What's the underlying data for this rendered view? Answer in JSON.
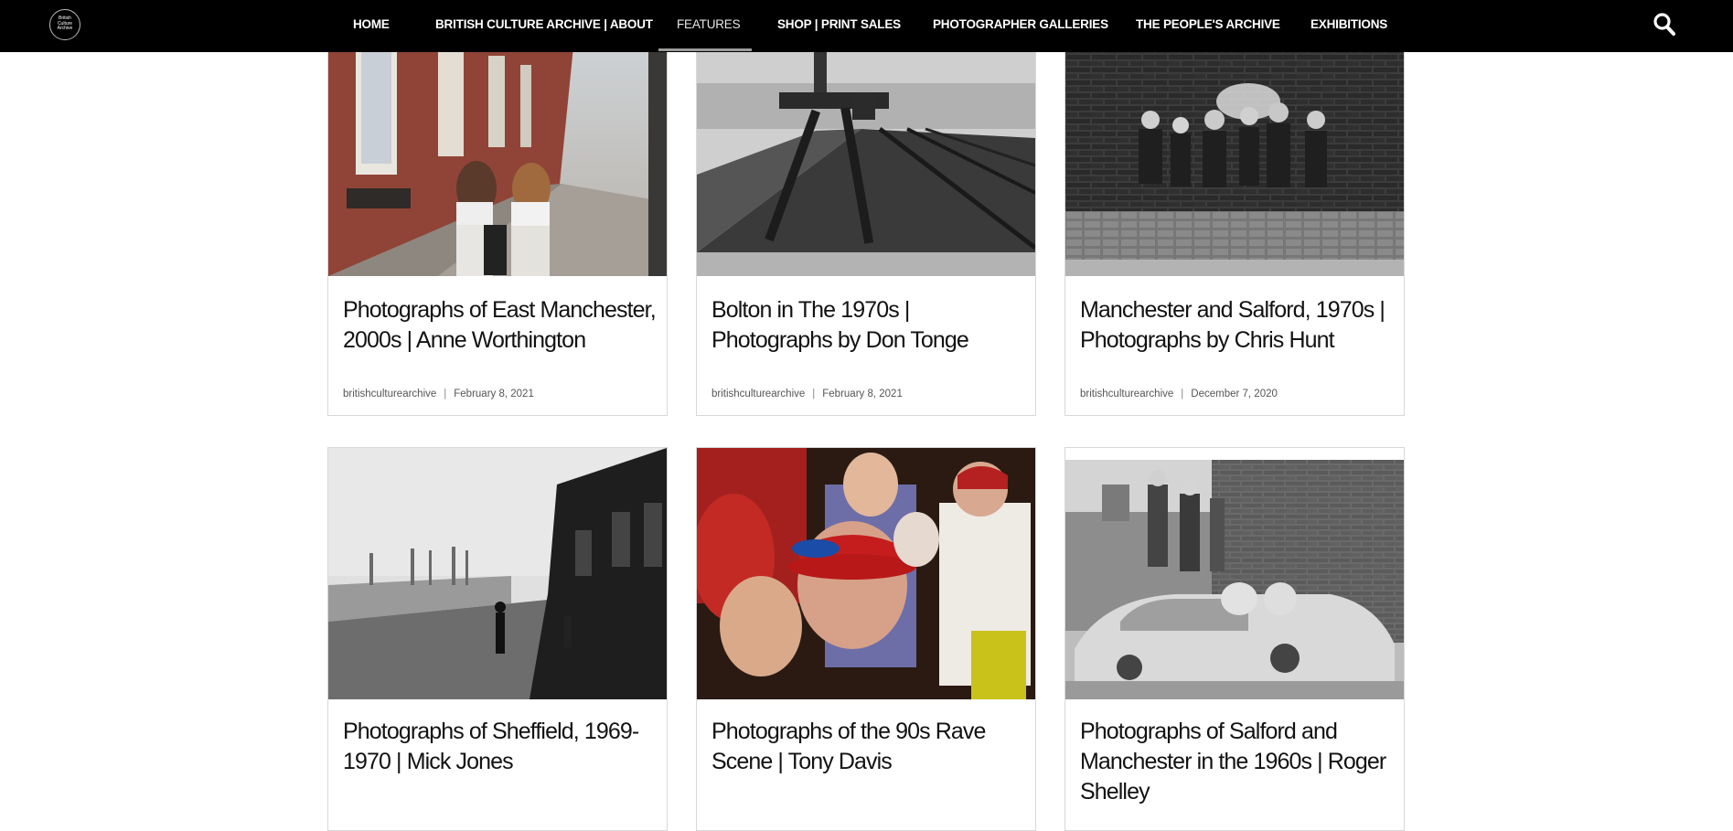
{
  "site": {
    "logo_text": "British Culture Archive",
    "nav": [
      {
        "label": "HOME"
      },
      {
        "label": "BRITISH CULTURE ARCHIVE | ABOUT"
      },
      {
        "label": "FEATURES"
      },
      {
        "label": "SHOP | PRINT SALES"
      },
      {
        "label": "PHOTOGRAPHER GALLERIES"
      },
      {
        "label": "THE PEOPLE'S ARCHIVE"
      },
      {
        "label": "EXHIBITIONS"
      }
    ],
    "active_nav": "FEATURES",
    "search_icon": "search-icon"
  },
  "posts": [
    {
      "title": "Photographs of East Manchester, 2000s | Anne Worthington",
      "author": "britishculturearchive",
      "date": "February 8, 2021",
      "image": "colour street photo of two girls with a pram"
    },
    {
      "title": "Bolton in The 1970s | Photographs by Don Tonge",
      "author": "britishculturearchive",
      "date": "February 8, 2021",
      "image": "black and white photo of railway track"
    },
    {
      "title": "Manchester and Salford, 1970s | Photographs by Chris Hunt",
      "author": "britishculturearchive",
      "date": "December 7, 2020",
      "image": "black and white photo of children against brick wall"
    },
    {
      "title": "Photographs of Sheffield, 1969-1970 | Mick Jones",
      "author": "",
      "date": "",
      "image": "black and white terraced street"
    },
    {
      "title": "Photographs of the 90s Rave Scene | Tony Davis",
      "author": "",
      "date": "",
      "image": "colour photo of rave crowd"
    },
    {
      "title": "Photographs of Salford and Manchester in the 1960s | Roger Shelley",
      "author": "",
      "date": "",
      "image": "black and white children on an abandoned car"
    }
  ],
  "colors": {
    "nav_bg": "#000000",
    "nav_text": "#ffffff",
    "card_border": "#d8d8d8",
    "title_text": "#121212"
  }
}
